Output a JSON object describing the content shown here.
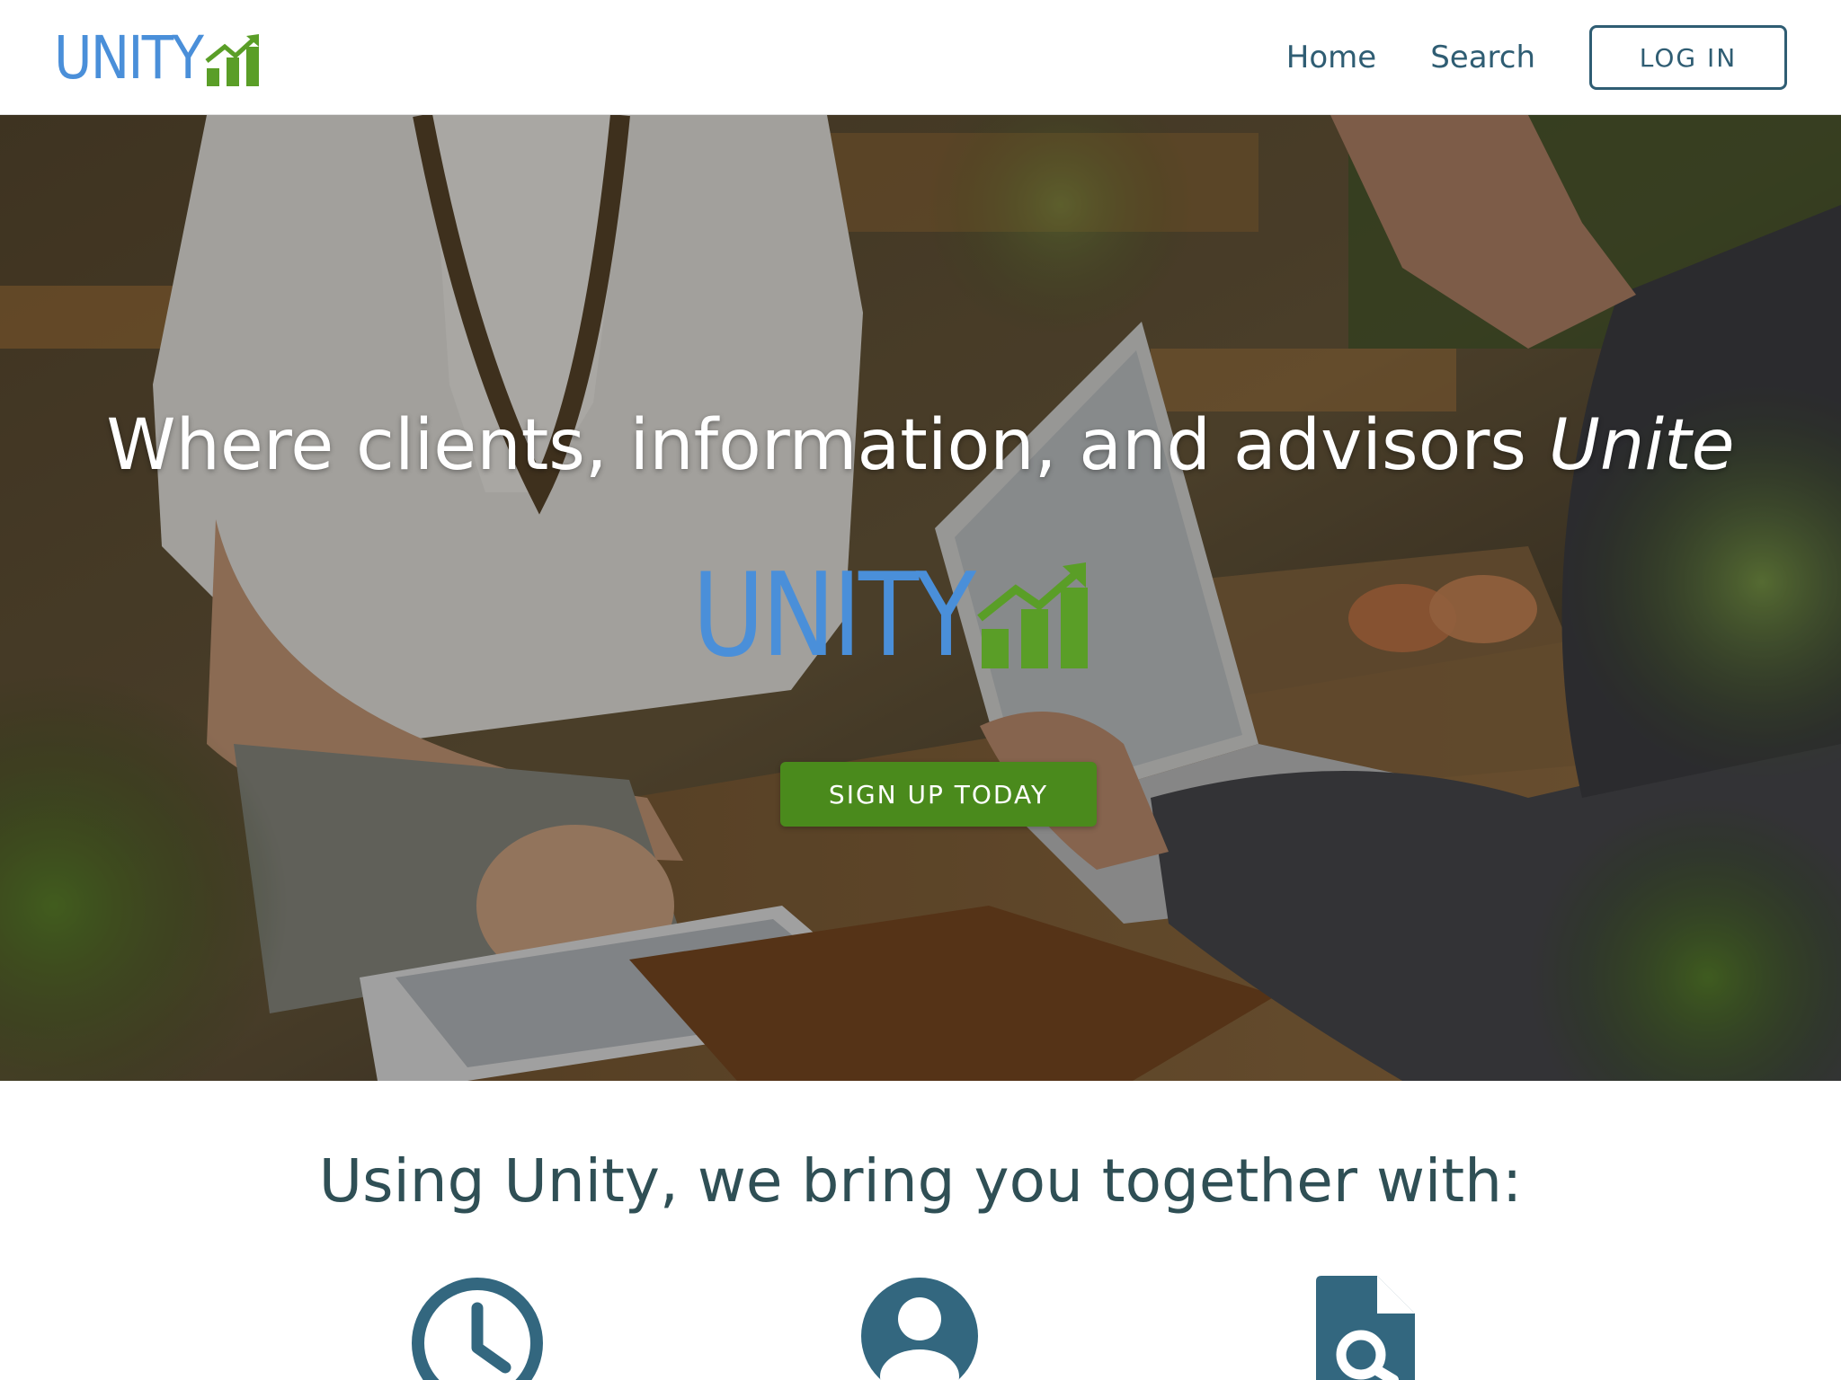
{
  "navbar": {
    "logo_text": "UNITY",
    "links": [
      {
        "label": "Home"
      },
      {
        "label": "Search"
      }
    ],
    "login_label": "LOG IN"
  },
  "hero": {
    "headline": "Where clients, information, and advisors ",
    "headline_accent": "Unite",
    "logo_text": "UNITY",
    "signup_label": "SIGN UP TODAY"
  },
  "features": {
    "heading": "Using Unity, we bring you together with:",
    "icons": [
      "clock-icon",
      "user-circle-icon",
      "file-search-icon"
    ]
  },
  "colors": {
    "logo_blue": "#4a8fd9",
    "logo_green": "#5a9e27",
    "nav_text": "#2f5d73",
    "signup_green": "#4a8a1c",
    "heading_text": "#2f4f55",
    "icon_color": "#33677f"
  }
}
